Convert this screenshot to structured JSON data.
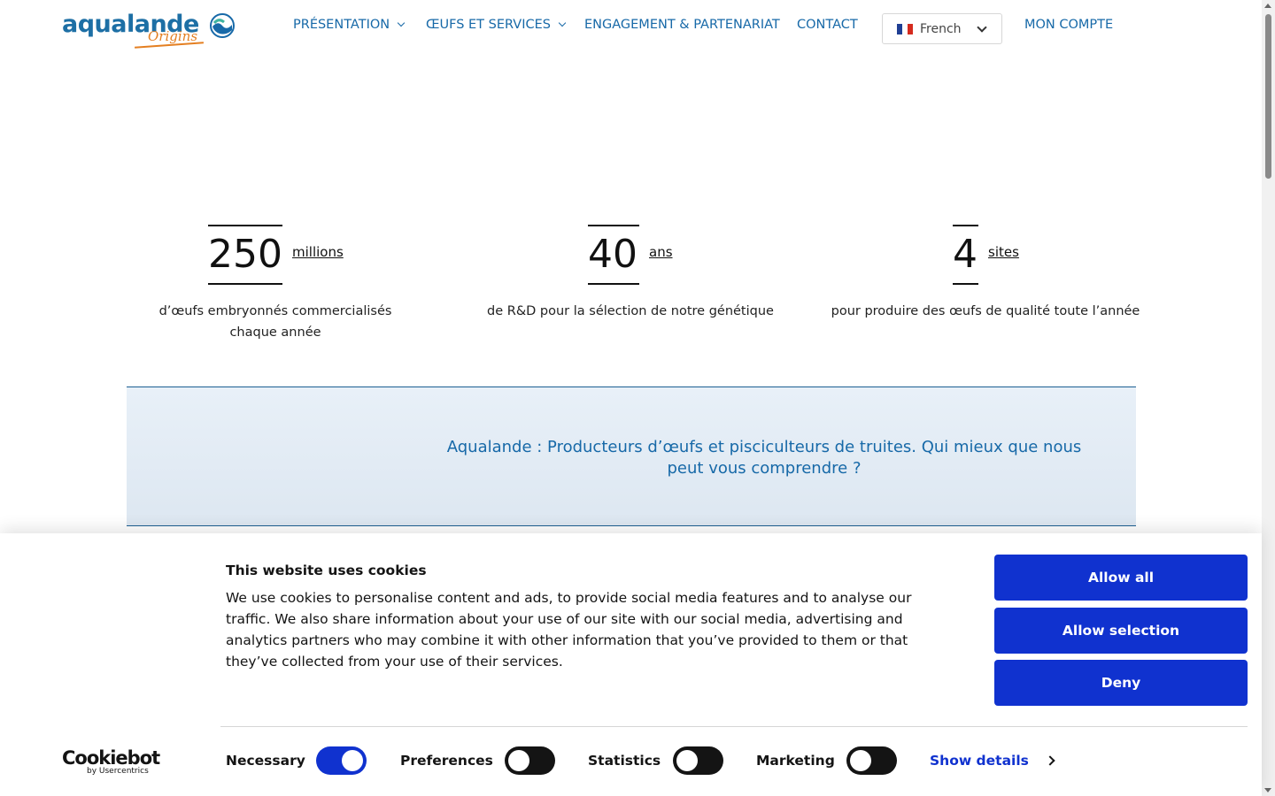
{
  "header": {
    "logo": {
      "main": "aqualande",
      "sub": "Origins"
    },
    "nav": [
      {
        "label": "PRÉSENTATION",
        "dropdown": true
      },
      {
        "label": "ŒUFS ET SERVICES",
        "dropdown": true
      },
      {
        "label": "ENGAGEMENT & PARTENARIAT",
        "dropdown": false
      },
      {
        "label": "CONTACT",
        "dropdown": false
      }
    ],
    "language": {
      "selected": "French",
      "flag": "fr-flag-icon"
    },
    "account": "MON COMPTE"
  },
  "stats": [
    {
      "number": "250",
      "unit": "millions",
      "description": "d’œufs embryonnés  commercialisés chaque année"
    },
    {
      "number": "40",
      "unit": "ans",
      "description": "de R&D pour la sélection de notre génétique"
    },
    {
      "number": "4",
      "unit": "sites",
      "description": "pour produire des œufs de qualité toute l’année"
    }
  ],
  "banner": {
    "text": "Aqualande : Producteurs d’œufs et pisciculteurs de truites. Qui mieux que nous peut vous comprendre ?"
  },
  "cookie": {
    "title": "This website uses cookies",
    "body": "We use cookies to personalise content and ads, to provide social media features and to analyse our traffic. We also share information about your use of our site with our social media, advertising and analytics partners who may combine it with other information that you’ve provided to them or that they’ve collected from your use of their services.",
    "buttons": {
      "allow_all": "Allow all",
      "allow_selection": "Allow selection",
      "deny": "Deny"
    },
    "brand": {
      "main": "Cookiebot",
      "sub": "by Usercentrics"
    },
    "consents": [
      {
        "label": "Necessary",
        "checked": true
      },
      {
        "label": "Preferences",
        "checked": false
      },
      {
        "label": "Statistics",
        "checked": false
      },
      {
        "label": "Marketing",
        "checked": false
      }
    ],
    "show_details": "Show details"
  },
  "colors": {
    "brand_blue": "#1769a8",
    "cookie_blue": "#1032cf",
    "orange": "#e47f21",
    "banner_bg": "#e8f0f8"
  }
}
